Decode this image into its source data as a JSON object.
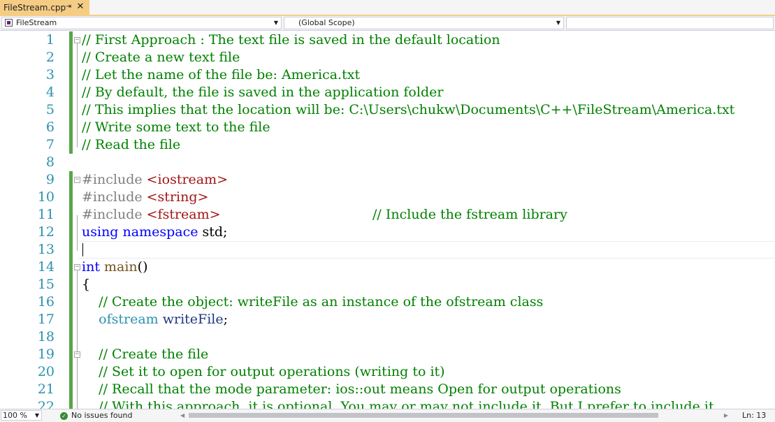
{
  "tab": {
    "title": "FileStream.cpp",
    "pin_icon": "pin-icon",
    "close_icon": "close-icon"
  },
  "navbar": {
    "project": "FileStream",
    "scope": "(Global Scope)",
    "member": ""
  },
  "editor": {
    "current_line": 13,
    "lines": [
      {
        "num": "1",
        "fold": "⊟",
        "segments": [
          {
            "t": "// First Approach : The text file is saved in the default location",
            "c": "com"
          }
        ]
      },
      {
        "num": "2",
        "segments": [
          {
            "t": "// Create a new text file",
            "c": "com"
          }
        ]
      },
      {
        "num": "3",
        "segments": [
          {
            "t": "// Let the name of the file be: America.txt",
            "c": "com"
          }
        ]
      },
      {
        "num": "4",
        "segments": [
          {
            "t": "// By default, the file is saved in the application folder",
            "c": "com"
          }
        ]
      },
      {
        "num": "5",
        "segments": [
          {
            "t": "// This implies that the location will be: C:\\Users\\chukw\\Documents\\C++\\FileStream\\America.txt",
            "c": "com"
          }
        ]
      },
      {
        "num": "6",
        "segments": [
          {
            "t": "// Write some text to the file",
            "c": "com"
          }
        ]
      },
      {
        "num": "7",
        "segments": [
          {
            "t": "// Read the file",
            "c": "com"
          }
        ]
      },
      {
        "num": "8",
        "segments": []
      },
      {
        "num": "9",
        "fold": "⊟",
        "segments": [
          {
            "t": "#include ",
            "c": "pre"
          },
          {
            "t": "<iostream>",
            "c": "str"
          }
        ]
      },
      {
        "num": "10",
        "segments": [
          {
            "t": "#include ",
            "c": "pre"
          },
          {
            "t": "<string>",
            "c": "str"
          }
        ]
      },
      {
        "num": "11",
        "segments": [
          {
            "t": "#include ",
            "c": "pre"
          },
          {
            "t": "<fstream>",
            "c": "str"
          },
          {
            "t": "                                    ",
            "c": "ns"
          },
          {
            "t": "// Include the fstream library",
            "c": "com"
          }
        ]
      },
      {
        "num": "12",
        "segments": [
          {
            "t": "using",
            "c": "kw"
          },
          {
            "t": " ",
            "c": "ns"
          },
          {
            "t": "namespace",
            "c": "kw"
          },
          {
            "t": " std;",
            "c": "ns"
          }
        ]
      },
      {
        "num": "13",
        "segments": []
      },
      {
        "num": "14",
        "fold": "⊟",
        "segments": [
          {
            "t": "int",
            "c": "kw"
          },
          {
            "t": " ",
            "c": "ns"
          },
          {
            "t": "main",
            "c": "fn"
          },
          {
            "t": "()",
            "c": "ns"
          }
        ]
      },
      {
        "num": "15",
        "segments": [
          {
            "t": "{",
            "c": "ns"
          }
        ]
      },
      {
        "num": "16",
        "segments": [
          {
            "t": "    ",
            "c": "ns"
          },
          {
            "t": "// Create the object: writeFile as an instance of the ofstream class",
            "c": "com"
          }
        ]
      },
      {
        "num": "17",
        "segments": [
          {
            "t": "    ",
            "c": "ns"
          },
          {
            "t": "ofstream",
            "c": "type"
          },
          {
            "t": " ",
            "c": "ns"
          },
          {
            "t": "writeFile",
            "c": "var"
          },
          {
            "t": ";",
            "c": "ns"
          }
        ]
      },
      {
        "num": "18",
        "segments": []
      },
      {
        "num": "19",
        "fold": "⊟",
        "segments": [
          {
            "t": "    ",
            "c": "ns"
          },
          {
            "t": "// Create the file",
            "c": "com"
          }
        ]
      },
      {
        "num": "20",
        "segments": [
          {
            "t": "    ",
            "c": "ns"
          },
          {
            "t": "// Set it to open for output operations (writing to it)",
            "c": "com"
          }
        ]
      },
      {
        "num": "21",
        "segments": [
          {
            "t": "    ",
            "c": "ns"
          },
          {
            "t": "// Recall that the mode parameter: ios::out means Open for output operations",
            "c": "com"
          }
        ]
      },
      {
        "num": "22",
        "segments": [
          {
            "t": "    ",
            "c": "ns"
          },
          {
            "t": "// With this approach, it is optional. You may or may not include it. But I prefer to include it",
            "c": "com"
          }
        ]
      }
    ]
  },
  "status": {
    "zoom": "100 %",
    "issues": "No issues found",
    "issues_icon": "check-circle-icon",
    "line": "Ln: 13"
  },
  "colors": {
    "tab_active": "#f5cc84",
    "line_number": "#2b91af",
    "comment": "#008000",
    "keyword": "#0000ff",
    "string": "#a31515",
    "change_marker": "#57a64a"
  }
}
